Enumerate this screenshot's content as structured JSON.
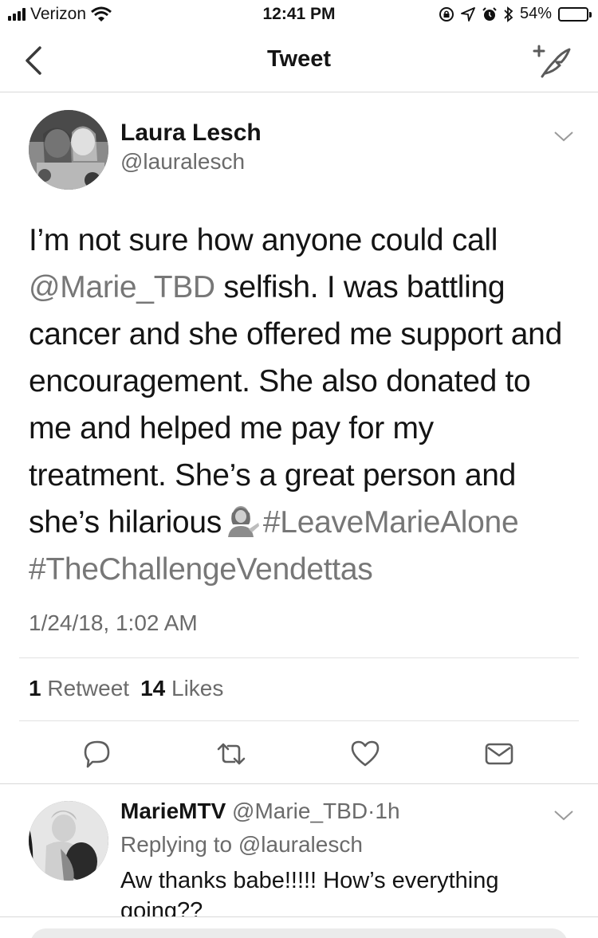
{
  "status_bar": {
    "carrier": "Verizon",
    "time": "12:41 PM",
    "battery_percent": "54%",
    "battery_level": 0.54,
    "icons": [
      "signal-icon",
      "wifi-icon",
      "lock-rotation-icon",
      "location-icon",
      "alarm-icon",
      "bluetooth-icon",
      "battery-icon"
    ]
  },
  "nav": {
    "title": "Tweet",
    "back_icon": "chevron-left-icon",
    "compose_icon": "compose-tweet-icon"
  },
  "tweet": {
    "author_name": "Laura Lesch",
    "author_handle": "@lauralesch",
    "lines": [
      {
        "text": "I’m not sure how anyone could call"
      },
      {
        "mention": "@Marie_TBD",
        "text": " selfish. I was battling"
      },
      {
        "text": "cancer and she offered me support and"
      },
      {
        "text": "encouragement. She also donated to"
      },
      {
        "text": "me and helped me pay for my"
      },
      {
        "text": "treatment. She’s a great person and"
      },
      {
        "text": "she’s hilarious",
        "emoji": "person-tipping-hand-emoji",
        "hashtag": "#LeaveMarieAlone"
      },
      {
        "hashtag": "#TheChallengeVendettas"
      }
    ],
    "timestamp": "1/24/18, 1:02 AM",
    "retweet_count": "1",
    "retweet_label": "Retweet",
    "like_count": "14",
    "like_label": "Likes",
    "actions": [
      "reply-icon",
      "retweet-icon",
      "like-icon",
      "share-icon"
    ]
  },
  "reply": {
    "author_name": "MarieMTV",
    "author_handle": "@Marie_TBD",
    "separator": "·",
    "age": "1h",
    "replying_prefix": "Replying to",
    "replying_handle": "@lauralesch",
    "text": "Aw thanks babe!!!!! How’s everything going??"
  }
}
